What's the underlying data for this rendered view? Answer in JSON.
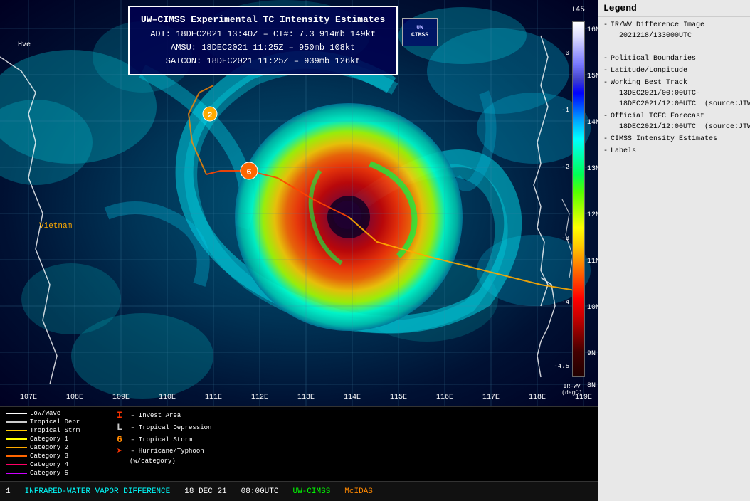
{
  "header": {
    "title": "UW–CIMSS Experimental TC Intensity Estimates",
    "adt_line": "ADT: 18DEC2021 13:40Z – CI#: 7.3  914mb  149kt",
    "amsu_line": "AMSU: 18DEC2021 11:25Z – 950mb  108kt",
    "satcon_line": "SATCON: 18DEC2021 11:25Z – 939mb  126kt"
  },
  "status_bar": {
    "item1": "1",
    "item2": "INFRARED-WATER VAPOR DIFFERENCE",
    "item3": "18 DEC 21",
    "item4": "08:00UTC",
    "item5": "UW-CIMSS",
    "item6": "McIDAS"
  },
  "map_labels": {
    "vietnam": "Vietnam",
    "hve": "Hve",
    "lons": [
      "107E",
      "108E",
      "109E",
      "110E",
      "111E",
      "112E",
      "113E",
      "114E",
      "115E",
      "116E",
      "117E",
      "118E",
      "119E"
    ],
    "lats": [
      "16N",
      "15N",
      "14N",
      "13N",
      "12N",
      "11N",
      "10N",
      "9N",
      "8N"
    ]
  },
  "scale": {
    "plus45": "+45",
    "values": [
      "0",
      "-1",
      "-2",
      "-3",
      "-4",
      "-4.5"
    ],
    "label_bottom": "IR–WV\n(degC)"
  },
  "legend_panel": {
    "header": "Legend",
    "items": [
      "- IR/WV Difference Image",
      "  2021218/133000UTC",
      "",
      "- Political Boundaries",
      "- Latitude/Longitude",
      "- Working Best Track",
      "  13DEC2021/00:00UTC–",
      "  18DEC2021/12:00UTC  (source:JTWC)",
      "- Official TCFC Forecast",
      "  18DEC2021/12:00UTC  (source:JTWC)",
      "- CIMSS Intensity Estimates",
      "- Labels"
    ]
  },
  "bottom_legend": {
    "track_types": [
      {
        "label": "Low/Wave",
        "color": "#ffffff"
      },
      {
        "label": "Tropical Depr",
        "color": "#cccccc"
      },
      {
        "label": "Tropical Strm",
        "color": "#ffcc00"
      },
      {
        "label": "Category 1",
        "color": "#ffff00"
      },
      {
        "label": "Category 2",
        "color": "#ffaa00"
      },
      {
        "label": "Category 3",
        "color": "#ff6600"
      },
      {
        "label": "Category 4",
        "color": "#ff0066"
      },
      {
        "label": "Category 5",
        "color": "#cc00ff"
      }
    ],
    "symbol_types": [
      {
        "symbol": "I",
        "color": "#ff3300",
        "label": "– Invest Area"
      },
      {
        "symbol": "L",
        "color": "#cccccc",
        "label": "– Tropical Depression"
      },
      {
        "symbol": "6",
        "color": "#ff8800",
        "label": "– Tropical Storm"
      },
      {
        "symbol": "➤",
        "color": "#ff3300",
        "label": "– Hurricane/Typhoon"
      },
      {
        "label_extra": "(w/category)"
      }
    ]
  }
}
